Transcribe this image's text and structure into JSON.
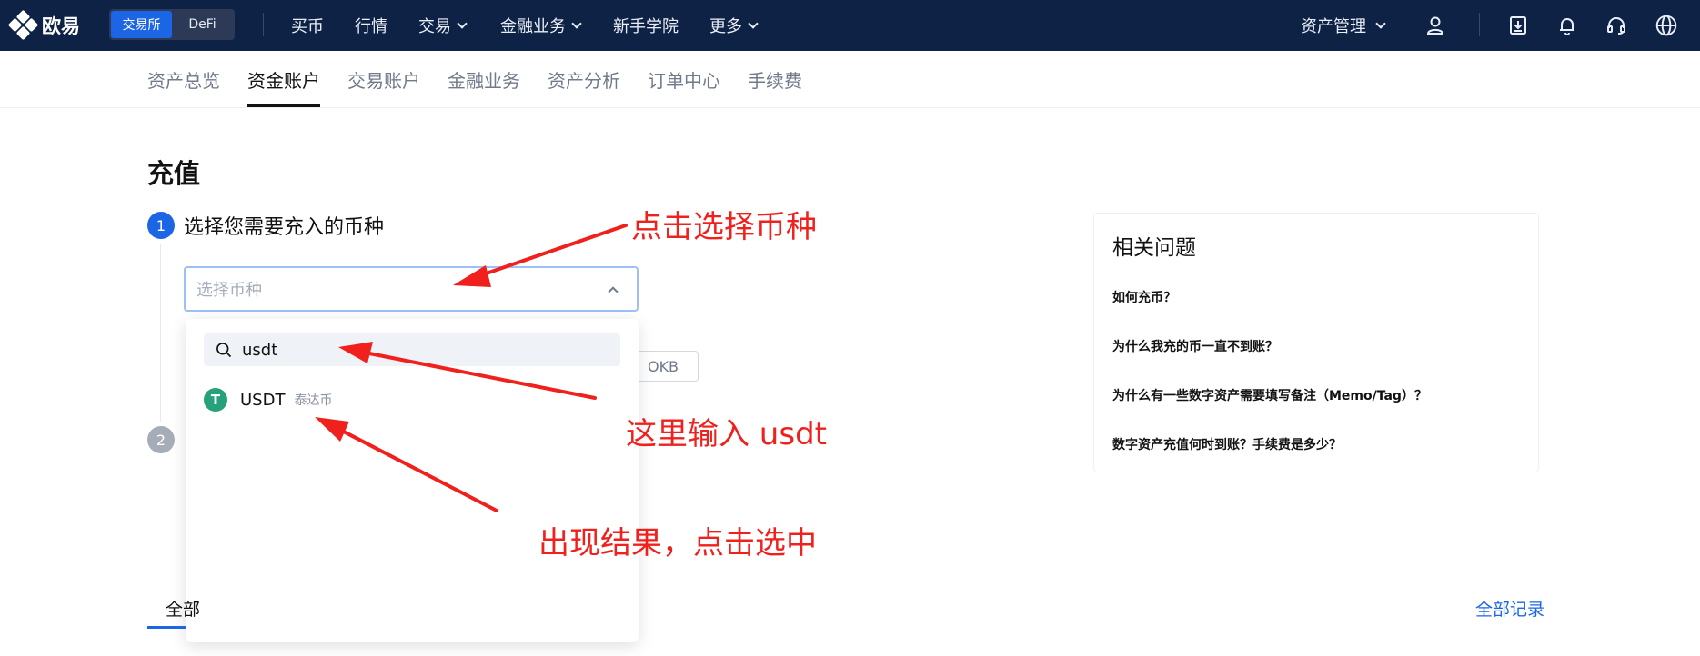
{
  "brand": {
    "logo_text": "欧易"
  },
  "mode_switch": {
    "exchange_label": "交易所",
    "defi_label": "DeFi"
  },
  "top_nav": {
    "items": [
      "买币",
      "行情",
      "交易",
      "金融业务",
      "新手学院",
      "更多"
    ],
    "asset_management": "资产管理"
  },
  "sub_nav": {
    "tabs": [
      "资产总览",
      "资金账户",
      "交易账户",
      "金融业务",
      "资产分析",
      "订单中心",
      "手续费"
    ],
    "active_index": 1
  },
  "page": {
    "title": "充值",
    "step1": {
      "number": "1",
      "label": "选择您需要充入的币种"
    },
    "step2": {
      "number": "2"
    },
    "coin_select_placeholder": "选择币种",
    "search_value": "usdt",
    "result": {
      "symbol": "USDT",
      "name": "泰达币",
      "icon_glyph": "T"
    },
    "hot_chip": "OKB",
    "tab_fragment": "全部",
    "all_records": "全部记录"
  },
  "faq": {
    "title": "相关问题",
    "questions": [
      "如何充币？",
      "为什么我充的币一直不到账？",
      "为什么有一些数字资产需要填写备注（Memo/Tag）？",
      "数字资产充值何时到账？手续费是多少？"
    ]
  },
  "annotations": {
    "select_coin": "点击选择币种",
    "type_usdt": "这里输入 usdt",
    "result_click": "出现结果，点击选中"
  },
  "colors": {
    "nav_bg": "#0e2246",
    "accent": "#1c66e5",
    "annotation": "#f0201d",
    "usdt": "#26a17b"
  },
  "icons": [
    "user-icon",
    "download-icon",
    "bell-icon",
    "headset-icon",
    "globe-icon",
    "search-icon",
    "chevron-up-icon",
    "chevron-down-icon"
  ]
}
